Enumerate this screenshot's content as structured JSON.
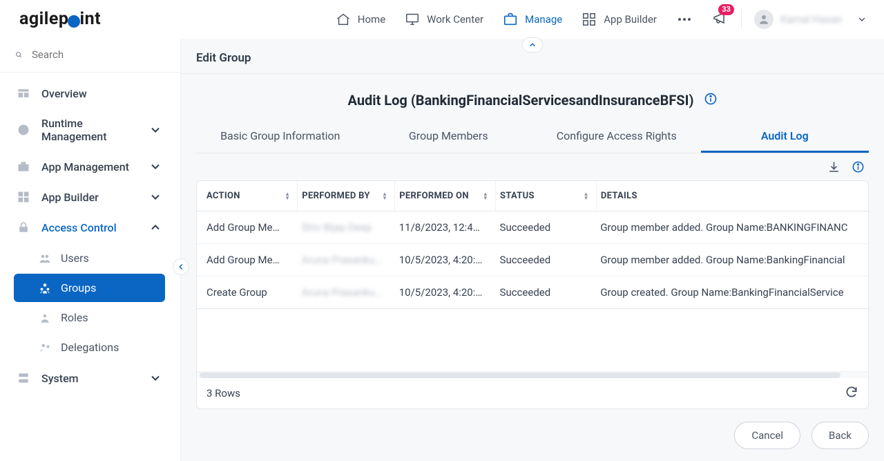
{
  "header": {
    "logo_a": "agilep",
    "logo_b": "int",
    "nav": [
      "Home",
      "Work Center",
      "Manage",
      "App Builder"
    ],
    "active_nav_index": 2,
    "badge": "33",
    "user_name": "Kamal Hasan"
  },
  "sidebar": {
    "search_placeholder": "Search",
    "items": [
      {
        "label": "Overview",
        "expandable": false
      },
      {
        "label": "Runtime Management",
        "expandable": true,
        "expanded": false
      },
      {
        "label": "App Management",
        "expandable": true,
        "expanded": false
      },
      {
        "label": "App Builder",
        "expandable": true,
        "expanded": false
      },
      {
        "label": "Access Control",
        "expandable": true,
        "expanded": true
      },
      {
        "label": "System",
        "expandable": true,
        "expanded": false
      }
    ],
    "access_control_children": [
      {
        "label": "Users",
        "active": false
      },
      {
        "label": "Groups",
        "active": true
      },
      {
        "label": "Roles",
        "active": false
      },
      {
        "label": "Delegations",
        "active": false
      }
    ]
  },
  "content": {
    "section_title": "Edit Group",
    "page_title": "Audit Log (BankingFinancialServicesandInsuranceBFSI)",
    "tabs": [
      "Basic Group Information",
      "Group Members",
      "Configure Access Rights",
      "Audit Log"
    ],
    "active_tab_index": 3,
    "columns": [
      "ACTION",
      "PERFORMED BY",
      "PERFORMED ON",
      "STATUS",
      "DETAILS"
    ],
    "rows": [
      {
        "action": "Add Group Mem…",
        "performed_by": "Shiv Bijay Deep",
        "performed_on": "11/8/2023, 12:4…",
        "status": "Succeeded",
        "details": "Group member added. Group Name:BANKINGFINANC"
      },
      {
        "action": "Add Group Mem…",
        "performed_by": "Aruna Prasanku…",
        "performed_on": "10/5/2023, 4:20:…",
        "status": "Succeeded",
        "details": "Group member added. Group Name:BankingFinancial"
      },
      {
        "action": "Create Group",
        "performed_by": "Aruna Prasanku…",
        "performed_on": "10/5/2023, 4:20:…",
        "status": "Succeeded",
        "details": "Group created. Group Name:BankingFinancialService"
      }
    ],
    "row_count_label": "3 Rows",
    "buttons": {
      "cancel": "Cancel",
      "back": "Back"
    }
  }
}
